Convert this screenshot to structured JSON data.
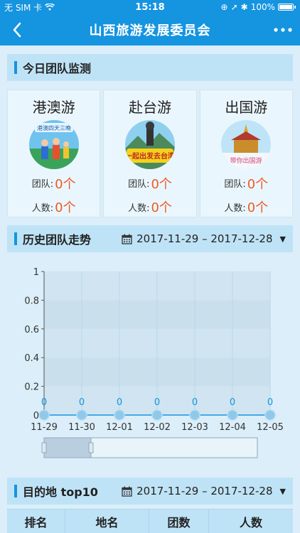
{
  "status": {
    "carrier": "无 SIM 卡",
    "time": "15:18",
    "battery": "100%"
  },
  "nav": {
    "title": "山西旅游发展委员会",
    "back_icon": "chevron-left-icon",
    "more_icon": "more-dots-icon"
  },
  "today": {
    "title": "今日团队监测",
    "cards": [
      {
        "title": "港澳游",
        "team_label": "团队:",
        "team_value": "0个",
        "people_label": "人数:",
        "people_value": "0个",
        "image_text": "港澳四天三晚"
      },
      {
        "title": "赴台游",
        "team_label": "团队:",
        "team_value": "0个",
        "people_label": "人数:",
        "people_value": "0个",
        "image_text": "一起出发去台湾"
      },
      {
        "title": "出国游",
        "team_label": "团队:",
        "team_value": "0个",
        "people_label": "人数:",
        "people_value": "0个",
        "image_text": "带你出国游"
      }
    ]
  },
  "history": {
    "title": "历史团队走势",
    "date_range": "2017-11-29 – 2017-12-28"
  },
  "chart_data": {
    "type": "line",
    "x": [
      "11-29",
      "11-30",
      "12-01",
      "12-02",
      "12-03",
      "12-04",
      "12-05"
    ],
    "series": [
      {
        "values": [
          0,
          0,
          0,
          0,
          0,
          0,
          0
        ]
      }
    ],
    "ylim": [
      0,
      1
    ],
    "yticks": [
      "0",
      "0.2",
      "0.4",
      "0.6",
      "0.8",
      "1"
    ],
    "grid": true,
    "color": "#1594e0"
  },
  "destination": {
    "title": "目的地 top10",
    "date_range": "2017-11-29 – 2017-12-28",
    "columns": [
      "排名",
      "地名",
      "团数",
      "人数"
    ]
  }
}
